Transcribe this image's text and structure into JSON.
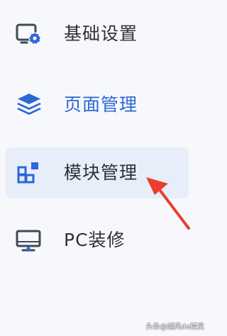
{
  "menu": {
    "items": [
      {
        "label": "基础设置",
        "icon": "settings-monitor-icon",
        "active": false
      },
      {
        "label": "页面管理",
        "icon": "layers-icon",
        "active": false
      },
      {
        "label": "模块管理",
        "icon": "grid-blocks-icon",
        "active": true
      },
      {
        "label": "PC装修",
        "icon": "desktop-monitor-icon",
        "active": false
      }
    ]
  },
  "annotation": {
    "arrow_color": "#ea3f2e"
  },
  "watermark": {
    "text": "头条@越风de精灵"
  },
  "colors": {
    "active_bg": "#e7eefa",
    "accent": "#2d67d6",
    "text_dark": "#2f3137"
  }
}
